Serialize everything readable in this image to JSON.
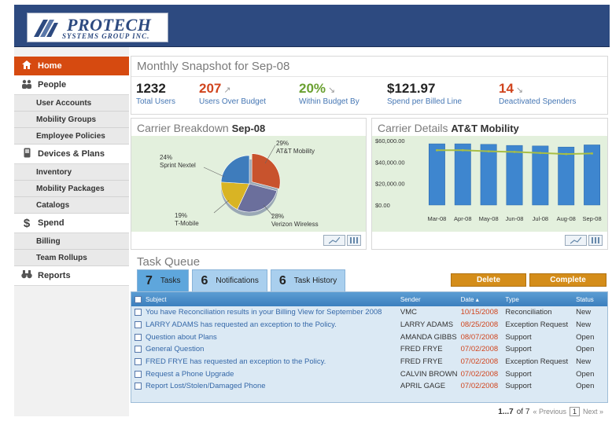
{
  "brand": {
    "name": "PROTECH",
    "tagline": "SYSTEMS GROUP INC.",
    "header_color": "#2d4a80",
    "accent_color": "#d64a10"
  },
  "sidebar": {
    "items": [
      {
        "label": "Home",
        "icon": "home-icon",
        "active": true
      },
      {
        "label": "People",
        "icon": "people-icon"
      },
      {
        "label": "User Accounts",
        "sub": true
      },
      {
        "label": "Mobility Groups",
        "sub": true
      },
      {
        "label": "Employee Policies",
        "sub": true
      },
      {
        "label": "Devices & Plans",
        "icon": "phone-icon"
      },
      {
        "label": "Inventory",
        "sub": true
      },
      {
        "label": "Mobility Packages",
        "sub": true
      },
      {
        "label": "Catalogs",
        "sub": true
      },
      {
        "label": "Spend",
        "icon": "dollar-icon"
      },
      {
        "label": "Billing",
        "sub": true
      },
      {
        "label": "Team Rollups",
        "sub": true
      },
      {
        "label": "Reports",
        "icon": "binoculars-icon"
      }
    ]
  },
  "snapshot": {
    "title": "Monthly Snapshot for Sep-08",
    "metrics": [
      {
        "value": "1232",
        "label": "Total Users",
        "arrow": ""
      },
      {
        "value": "207",
        "label": "Users Over Budget",
        "arrow": "↗"
      },
      {
        "value": "20%",
        "label": "Within Budget By",
        "arrow": "↘"
      },
      {
        "value": "$121.97",
        "label": "Spend per Billed Line",
        "arrow": ""
      },
      {
        "value": "14",
        "label": "Deactivated Spenders",
        "arrow": "↘"
      }
    ]
  },
  "breakdown": {
    "title": "Carrier Breakdown",
    "period": "Sep-08",
    "slices": [
      {
        "pct": "29%",
        "name": "AT&T Mobility",
        "value": 29,
        "color": "#c8532d"
      },
      {
        "pct": "28%",
        "name": "Verizon Wireless",
        "value": 28,
        "color": "#6b6f9c"
      },
      {
        "pct": "19%",
        "name": "T-Mobile",
        "value": 19,
        "color": "#d9b424"
      },
      {
        "pct": "24%",
        "name": "Sprint Nextel",
        "value": 24,
        "color": "#3e7cbc"
      }
    ]
  },
  "details": {
    "title": "Carrier Details",
    "carrier": "AT&T Mobility"
  },
  "chart_data": {
    "type": "bar",
    "categories": [
      "Mar-08",
      "Apr-08",
      "May-08",
      "Jun-08",
      "Jul-08",
      "Aug-08",
      "Sep-08"
    ],
    "series": [
      {
        "values": [
          57000,
          57000,
          56500,
          55500,
          55000,
          54000,
          56000
        ],
        "color": "#3e86cf"
      },
      {
        "values": [
          51000,
          51000,
          50000,
          49500,
          48500,
          47500,
          48000
        ],
        "color": "#a8be44"
      }
    ],
    "yticks": [
      "$60,000.00",
      "$40,000.00",
      "$20,000.00",
      "$0.00"
    ],
    "ylim": [
      0,
      60000
    ]
  },
  "taskqueue": {
    "title": "Task Queue",
    "tabs": [
      {
        "count": "7",
        "label": "Tasks"
      },
      {
        "count": "6",
        "label": "Notifications"
      },
      {
        "count": "6",
        "label": "Task History"
      }
    ],
    "delete_label": "Delete",
    "complete_label": "Complete",
    "columns": {
      "subject": "Subject",
      "sender": "Sender",
      "date": "Date",
      "type": "Type",
      "status": "Status"
    },
    "rows": [
      {
        "subject": "You have Reconciliation results in your Billing View for September 2008",
        "sender": "VMC",
        "date": "10/15/2008",
        "type": "Reconciliation",
        "status": "New"
      },
      {
        "subject": "LARRY ADAMS has requested an exception to the Policy.",
        "sender": "LARRY ADAMS",
        "date": "08/25/2008",
        "type": "Exception Request",
        "status": "New"
      },
      {
        "subject": "Question about Plans",
        "sender": "AMANDA GIBBS",
        "date": "08/07/2008",
        "type": "Support",
        "status": "Open"
      },
      {
        "subject": "General Question",
        "sender": "FRED FRYE",
        "date": "07/02/2008",
        "type": "Support",
        "status": "Open"
      },
      {
        "subject": "FRED FRYE has requested an exception to the Policy.",
        "sender": "FRED FRYE",
        "date": "07/02/2008",
        "type": "Exception Request",
        "status": "New"
      },
      {
        "subject": "Request a Phone Upgrade",
        "sender": "CALVIN BROWN",
        "date": "07/02/2008",
        "type": "Support",
        "status": "Open"
      },
      {
        "subject": "Report Lost/Stolen/Damaged Phone",
        "sender": "APRIL GAGE",
        "date": "07/02/2008",
        "type": "Support",
        "status": "Open"
      }
    ],
    "pager": {
      "range": "1...7",
      "of": "of 7",
      "prev": "« Previous",
      "page": "1",
      "next": "Next »"
    }
  }
}
